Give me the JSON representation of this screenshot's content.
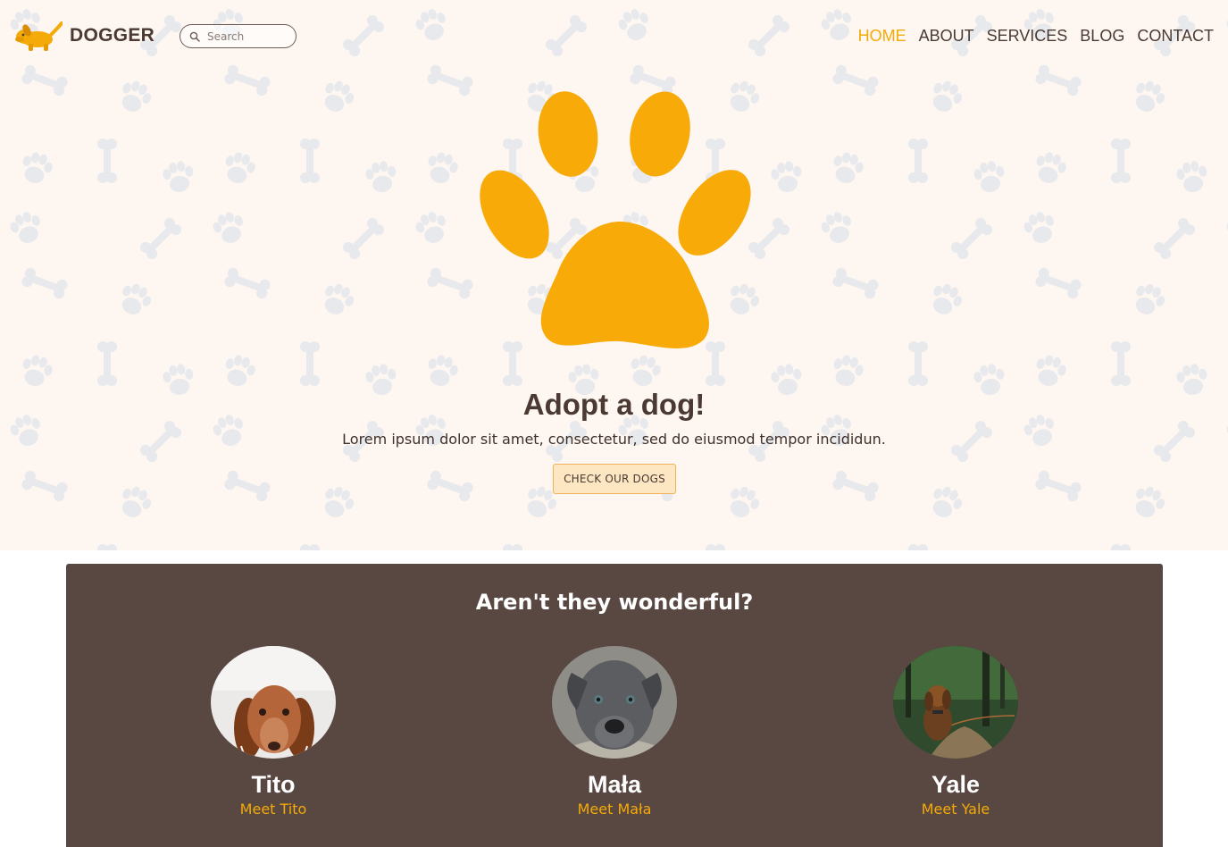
{
  "colors": {
    "accent": "#f4aa08",
    "hero_background": "#fef6f1",
    "section_background": "#594842",
    "text": "#4a3a33"
  },
  "header": {
    "logo": {
      "text": "DOGGER",
      "icon": "dog-logo-icon"
    },
    "search": {
      "placeholder": "Search",
      "value": "",
      "icon": "search-icon"
    },
    "nav": [
      {
        "label": "HOME",
        "active": true
      },
      {
        "label": "ABOUT",
        "active": false
      },
      {
        "label": "SERVICES",
        "active": false
      },
      {
        "label": "BLOG",
        "active": false
      },
      {
        "label": "CONTACT",
        "active": false
      }
    ]
  },
  "hero": {
    "icon": "paw-icon",
    "title": "Adopt a dog!",
    "subtitle": "Lorem ipsum dolor sit amet, consectetur, sed do eiusmod tempor incididun.",
    "button_label": "CHECK OUR DOGS"
  },
  "dogs_section": {
    "title": "Aren't they wonderful?",
    "dogs": [
      {
        "name": "Tito",
        "link": "Meet Tito",
        "photo": "dachshund-photo"
      },
      {
        "name": "Mała",
        "link": "Meet Mała",
        "photo": "grey-puppy-photo"
      },
      {
        "name": "Yale",
        "link": "Meet Yale",
        "photo": "spaniel-forest-photo"
      }
    ]
  }
}
